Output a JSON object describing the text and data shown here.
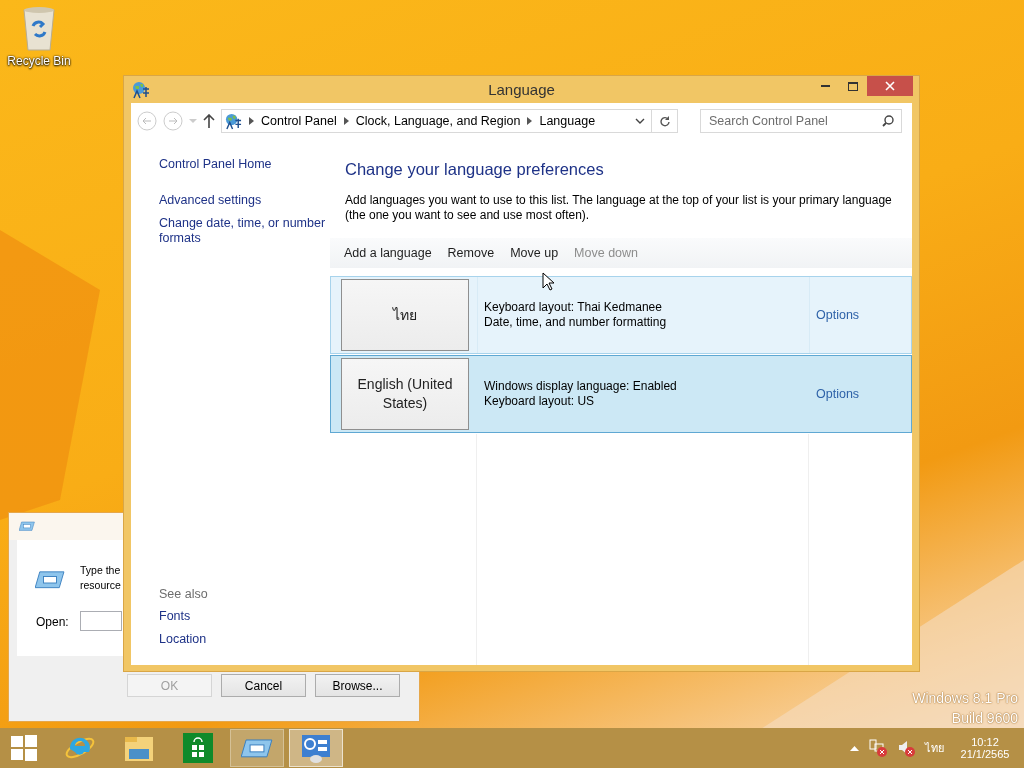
{
  "desktop": {
    "icons": [
      {
        "label": "Recycle Bin"
      }
    ],
    "watermark": [
      "Windows 8.1 Pro",
      "Build 9600"
    ]
  },
  "run_dialog": {
    "prompt": [
      "Type the",
      "resource"
    ],
    "open_label": "Open:",
    "buttons": [
      {
        "label": "OK",
        "disabled": true
      },
      {
        "label": "Cancel",
        "disabled": false
      },
      {
        "label": "Browse...",
        "disabled": false
      }
    ]
  },
  "window": {
    "title": "Language",
    "breadcrumb": [
      "Control Panel",
      "Clock, Language, and Region",
      "Language"
    ],
    "search": {
      "placeholder": "Search Control Panel"
    }
  },
  "sidebar": {
    "items": [
      "Control Panel Home",
      "Advanced settings",
      "Change date, time, or number formats"
    ],
    "see_also_title": "See also",
    "see_also": [
      "Fonts",
      "Location"
    ]
  },
  "main": {
    "heading": "Change your language preferences",
    "description": "Add languages you want to use to this list. The language at the top of your list is your primary language (the one you want to see and use most often).",
    "toolbar": [
      {
        "label": "Add a language",
        "disabled": false
      },
      {
        "label": "Remove",
        "disabled": false
      },
      {
        "label": "Move up",
        "disabled": false
      },
      {
        "label": "Move down",
        "disabled": true
      }
    ],
    "languages": [
      {
        "name": "ไทย",
        "details": [
          "Keyboard layout: Thai Kedmanee",
          "Date, time, and number formatting"
        ],
        "action": "Options",
        "selected": false
      },
      {
        "name": "English (United States)",
        "details": [
          "Windows display language: Enabled",
          "Keyboard layout: US"
        ],
        "action": "Options",
        "selected": true
      }
    ]
  },
  "taskbar": {
    "apps": [
      {
        "kind": "browser",
        "running": false,
        "selected": false
      },
      {
        "kind": "folder",
        "running": false,
        "selected": false
      },
      {
        "kind": "store",
        "running": false,
        "selected": false
      },
      {
        "kind": "run",
        "running": true,
        "selected": false
      },
      {
        "kind": "control-panel",
        "running": true,
        "selected": true
      }
    ],
    "language": "ไทย",
    "time": "10:12",
    "date": "21/1/2565"
  }
}
